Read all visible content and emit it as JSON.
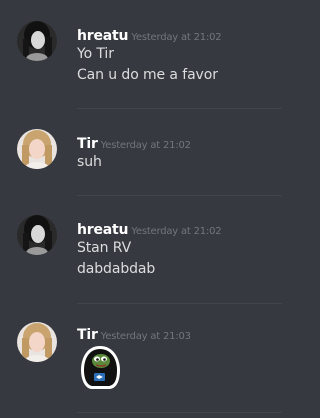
{
  "messages": [
    {
      "username": "hreatu",
      "timestamp": "Yesterday at 21:02",
      "avatar": "hreatu-avatar-dark",
      "lines": [
        "Yo Tir",
        "Can u do me a favor"
      ]
    },
    {
      "username": "Tir",
      "timestamp": "Yesterday at 21:02",
      "avatar": "tir-avatar-light",
      "lines": [
        "suh"
      ]
    },
    {
      "username": "hreatu",
      "timestamp": "Yesterday at 21:02",
      "avatar": "hreatu-avatar-dark",
      "lines": [
        "Stan RV",
        "dabdabdab"
      ]
    },
    {
      "username": "Tir",
      "timestamp": "Yesterday at 21:03",
      "avatar": "tir-avatar-light",
      "attachment": "pepe-hoodie-emoji"
    }
  ],
  "colors": {
    "background": "#36393f",
    "username": "#ffffff",
    "timestamp": "#72767d",
    "text": "#dcddde",
    "divider": "#40444b"
  }
}
